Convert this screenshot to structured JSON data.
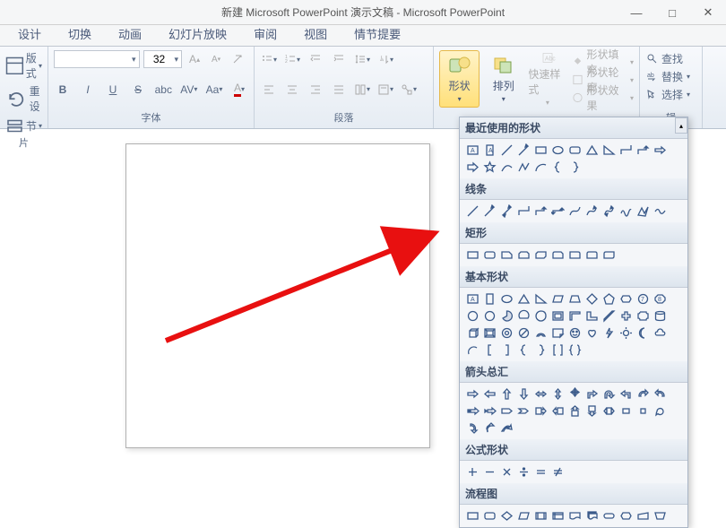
{
  "titlebar": {
    "title": "新建 Microsoft PowerPoint 演示文稿 - Microsoft PowerPoint"
  },
  "tabs": [
    "设计",
    "切换",
    "动画",
    "幻灯片放映",
    "审阅",
    "视图",
    "情节提要"
  ],
  "left_group": {
    "items": [
      "版式",
      "重设",
      "节"
    ],
    "label": "片"
  },
  "font_group": {
    "label": "字体",
    "font_name": "",
    "font_size": "32",
    "bold": "B",
    "italic": "I",
    "underline": "U",
    "strike": "S",
    "abc": "abc",
    "av": "AV",
    "aa": "Aa",
    "color_a": "A"
  },
  "paragraph_group": {
    "label": "段落"
  },
  "drawing_group": {
    "shapes_label": "形状",
    "arrange_label": "排列",
    "quickstyle_label": "快速样式",
    "fill": "形状填充",
    "outline": "形状轮廓",
    "effects": "形状效果"
  },
  "editing_group": {
    "find": "查找",
    "replace": "替换",
    "select": "选择",
    "label": "辑"
  },
  "panel": {
    "recent": "最近使用的形状",
    "lines": "线条",
    "rects": "矩形",
    "basic": "基本形状",
    "arrows": "箭头总汇",
    "equation": "公式形状",
    "flowchart": "流程图"
  },
  "chart_data": null
}
